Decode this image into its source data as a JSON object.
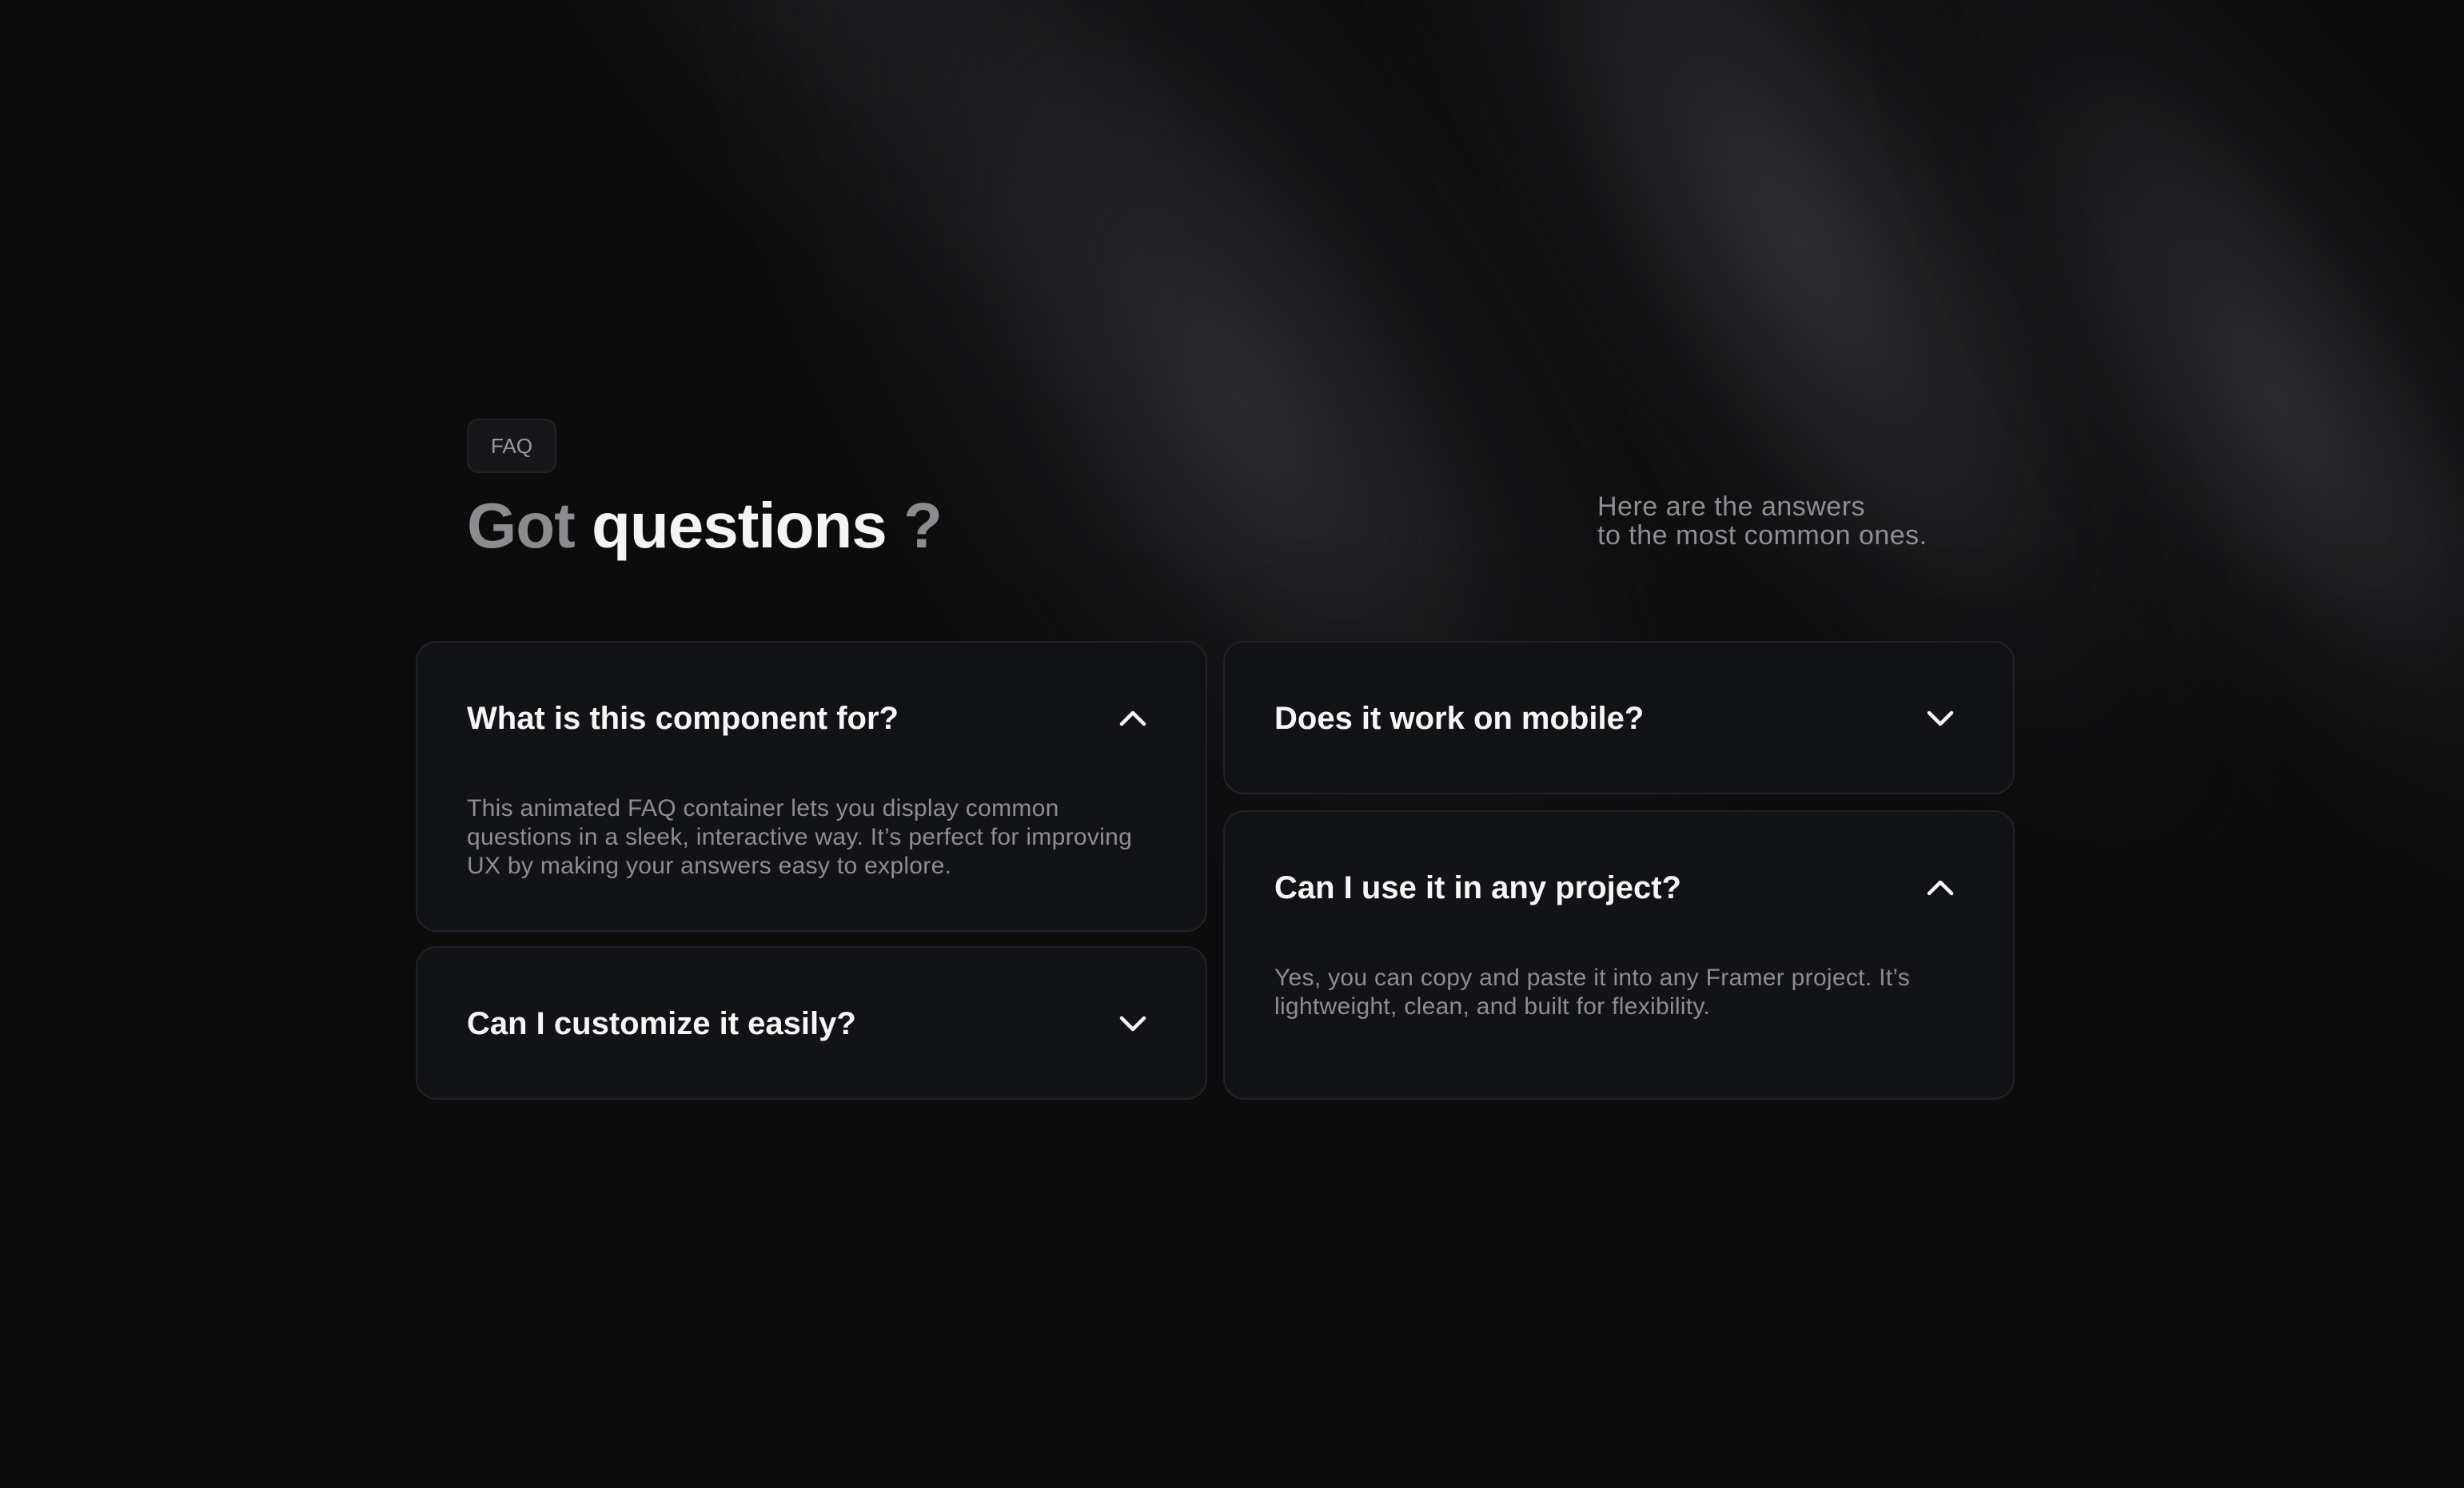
{
  "badge": "FAQ",
  "title": {
    "part1": "Got",
    "part2": "questions",
    "part3": "?"
  },
  "subtitle": {
    "line1": "Here are the answers",
    "line2": "to the most common ones."
  },
  "faq": [
    {
      "question": "What is this component for?",
      "answer": "This animated FAQ container lets you display common questions in a sleek, interactive way. It’s perfect for improving UX by making your answers easy to explore.",
      "state": "expanded",
      "icon": "chevron-up-icon"
    },
    {
      "question": "Does it work on mobile?",
      "state": "collapsed",
      "icon": "chevron-down-icon"
    },
    {
      "question": "Can I customize it easily?",
      "state": "collapsed",
      "icon": "chevron-down-icon"
    },
    {
      "question": "Can I use it in any project?",
      "answer": "Yes, you can copy and paste it into any Framer project. It’s lightweight, clean, and built for flexibility.",
      "state": "expanded",
      "icon": "chevron-up-icon"
    }
  ],
  "colors": {
    "background": "#0c0c0d",
    "card": "#121317",
    "card_border": "#22232a",
    "text_primary": "#f6f6f7",
    "text_muted": "#8d8d94"
  }
}
